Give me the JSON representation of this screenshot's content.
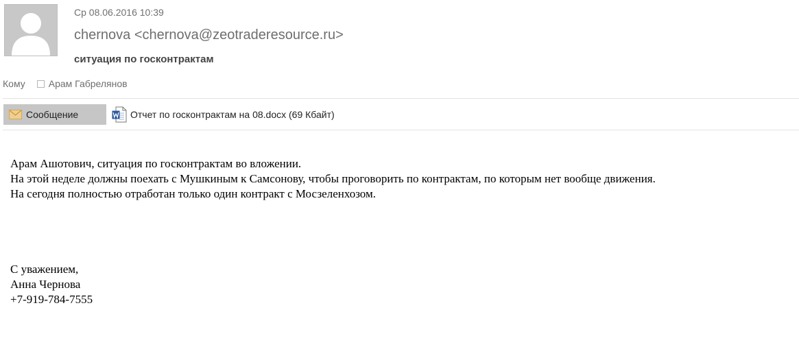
{
  "header": {
    "datetime": "Ср 08.06.2016 10:39",
    "sender": "chernova <chernova@zeotraderesource.ru>",
    "subject": "ситуация по госконтрактам",
    "to_label": "Кому",
    "recipient": "Арам Габрелянов"
  },
  "tabs": {
    "message_label": "Сообщение",
    "attachment_label": "Отчет по госконтрактам на 08.docx (69 Кбайт)"
  },
  "body": {
    "lines": [
      "Арам Ашотович, ситуация по госконтрактам во вложении.",
      "На этой неделе должны поехать с Мушкиным к Самсонову, чтобы проговорить по контрактам, по которым нет вообще движения.",
      "На сегодня полностью отработан только один контракт с Мосзеленхозом."
    ]
  },
  "signature": {
    "closing": "С уважением,",
    "name": "Анна Чернова",
    "phone": "+7-919-784-7555"
  },
  "icons": {
    "avatar": "person-silhouette-icon",
    "message": "envelope-icon",
    "attachment": "word-document-icon"
  },
  "colors": {
    "tab_background": "#c6c6c6",
    "avatar_background": "#c8c8c8",
    "word_blue": "#2b579a",
    "envelope": "#e8b964"
  }
}
